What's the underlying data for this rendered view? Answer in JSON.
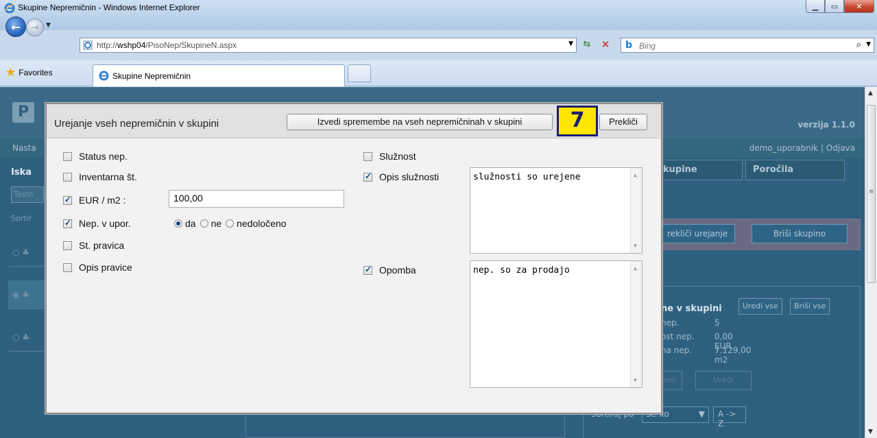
{
  "window": {
    "title": "Skupine Nepremičnin - Windows Internet Explorer",
    "url_prefix": "http://",
    "url_host": "wshp04",
    "url_path": "/PisoNep/SkupineN.aspx",
    "search_placeholder": "Bing"
  },
  "favorites": {
    "label": "Favorites",
    "tab_title": "Skupine Nepremičnin"
  },
  "background_page": {
    "logo_letter": "P",
    "version": "verzija 1.1.0",
    "nav_partial": "Nasta",
    "user": "demo_uporabnik  |  Odjava",
    "tab_skupine": "kupine",
    "tab_porocila": "Poročila",
    "iska_partial": "Iska",
    "test_partial": "Testn",
    "sort_partial": "Sortir",
    "prekl_urejanje": "rekliči urejanje",
    "brisi_skupino": "Briši skupino",
    "group_title": "ne v skupini",
    "uredi_vse": "Uredi vse",
    "brisi_vse": "Briši vse",
    "info": [
      {
        "label": "nep.",
        "value": "5"
      },
      {
        "label": "ost nep.",
        "value": "0,00 EUR"
      },
      {
        "label": "na nep.",
        "value": "7.129,00 m2"
      }
    ],
    "btn_emi": "emi",
    "btn_uredi": "Uredi",
    "sort_label": "Sortiraj po",
    "sort_value": "Št. ko",
    "sort_dir": "A -> Z"
  },
  "modal": {
    "title": "Urejanje vseh nepremičnin v skupini",
    "apply_label": "Izvedi spremembe na vseh nepremičninah v skupini",
    "cancel_label": "Prekliči",
    "step_number": "7",
    "left_fields": [
      {
        "label": "Status nep.",
        "checked": false
      },
      {
        "label": "Inventarna št.",
        "checked": false
      },
      {
        "label": "EUR / m2 :",
        "checked": true
      },
      {
        "label": "Nep. v upor.",
        "checked": true
      },
      {
        "label": "St. pravica",
        "checked": false
      },
      {
        "label": "Opis pravice",
        "checked": false
      }
    ],
    "eur_value": "100,00",
    "radio_options": [
      "da",
      "ne",
      "nedoločeno"
    ],
    "radio_selected": "da",
    "right_fields": [
      {
        "label": "Služnost",
        "checked": false
      },
      {
        "label": "Opis služnosti",
        "checked": true
      },
      {
        "label": "Opomba",
        "checked": true
      }
    ],
    "opis_sluznosti_text": "služnosti so urejene",
    "opomba_text": "nep. so za prodajo"
  }
}
